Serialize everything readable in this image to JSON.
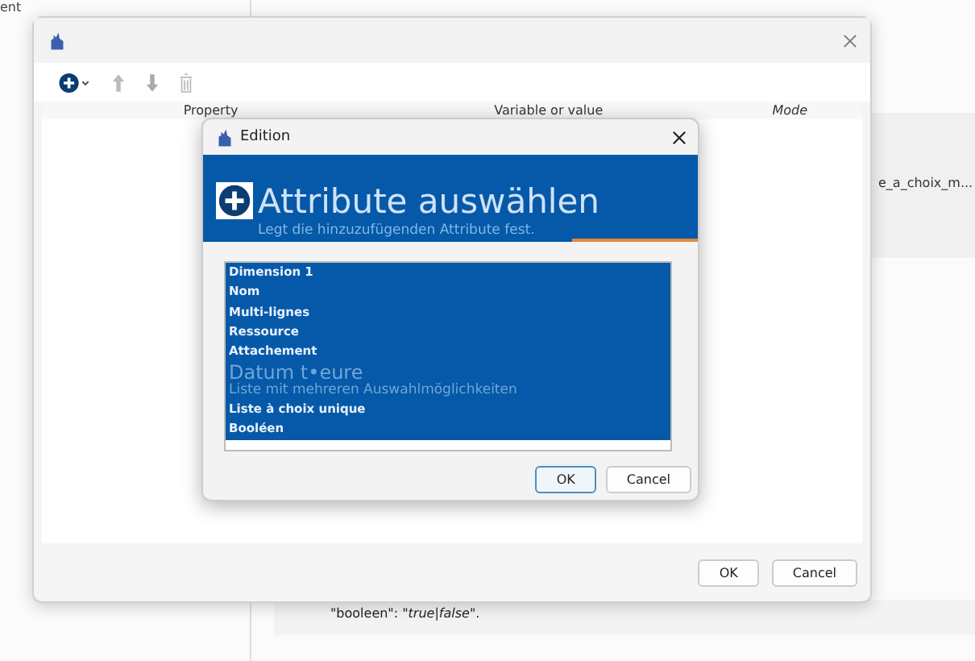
{
  "background": {
    "corner_text": "ent",
    "cell_text": "e_a_choix_m...",
    "code_line": "\"booleen\": \"*true|false*\"."
  },
  "dialog": {
    "toolbar": [
      {
        "kind": "add"
      },
      {
        "kind": "up"
      },
      {
        "kind": "down"
      },
      {
        "kind": "delete"
      }
    ],
    "columns": [
      "Property",
      "Variable or value",
      "Mode"
    ],
    "buttons": [
      "OK",
      "Cancel"
    ]
  },
  "edition": {
    "title": "Edition",
    "heading": "Attribute auswählen",
    "subtitle": "Legt die hinzuzufügenden Attribute fest.",
    "items": [
      {
        "label": "Dimension 1",
        "kind": "item",
        "selected": true
      },
      {
        "label": "Nom",
        "kind": "item",
        "selected": true
      },
      {
        "label": "Multi-lignes",
        "kind": "item",
        "selected": true
      },
      {
        "label": "Ressource",
        "kind": "item",
        "selected": true
      },
      {
        "label": "Attachement",
        "kind": "item",
        "selected": true
      },
      {
        "label": "Datum t•eure",
        "kind": "large",
        "selected": true
      },
      {
        "label": "Liste mit mehreren Auswahlmöglichkeiten",
        "kind": "medium",
        "selected": true
      },
      {
        "label": "Liste à choix unique",
        "kind": "item",
        "selected": true
      },
      {
        "label": "Booléen",
        "kind": "item",
        "selected": true
      }
    ],
    "buttons": [
      "OK",
      "Cancel"
    ]
  }
}
